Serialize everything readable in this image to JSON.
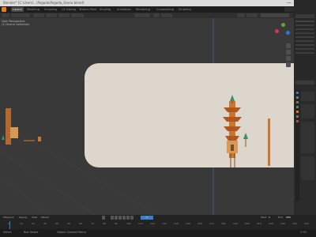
{
  "window": {
    "title": "Blender* [C:\\Users\\...\\Pagoda\\Pagoda_Scene.blend]",
    "minimize_label": "—",
    "maximize_label": "□",
    "close_label": "✕"
  },
  "menu": {
    "tabs": [
      "Layout",
      "Modeling",
      "Sculpting",
      "UV Editing",
      "Texture Paint",
      "Shading",
      "Animation",
      "Rendering",
      "Compositing",
      "Scripting"
    ],
    "active_tab": "Layout"
  },
  "viewport": {
    "view_label": "User Perspective",
    "collection_label": "(1) Scene Collection"
  },
  "timeline": {
    "playback_label": "Playback",
    "keying_label": "Keying",
    "view_label": "View",
    "marker_label": "Marker",
    "frame_ticks": [
      "0",
      "10",
      "20",
      "30",
      "40",
      "50",
      "60",
      "70",
      "80",
      "90",
      "100",
      "110",
      "120",
      "130",
      "140",
      "150",
      "160",
      "170",
      "180",
      "190",
      "200",
      "210",
      "220",
      "230",
      "240",
      "250"
    ],
    "current_frame": "1",
    "start_label": "Start",
    "start_value": "1",
    "end_label": "End",
    "end_value": "250"
  },
  "statusbar": {
    "select_label": "Select",
    "box_select_label": "Box Select",
    "rotate_label": "Rotate View",
    "context_menu_label": "Object Context Menu",
    "version_label": "2.93"
  },
  "colors": {
    "accent": "#3d7ec9",
    "camera_bg": "#ddd6cc",
    "pagoda": "#c8782e",
    "tree": "#3c8f5a"
  }
}
